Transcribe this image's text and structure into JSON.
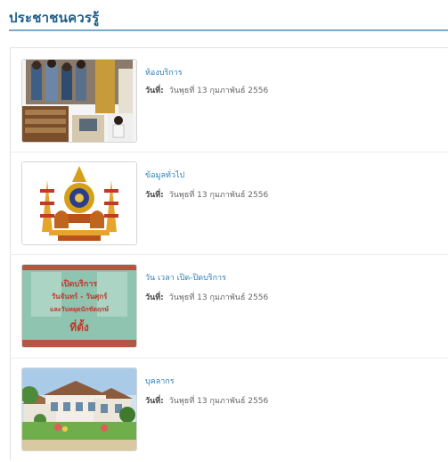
{
  "header": {
    "title": "ประชาชนควรรู้"
  },
  "date_label": "วันที่:",
  "items": [
    {
      "title": "ห้องบริการ",
      "date": "วันพุธที่ 13 กุมภาพันธ์ 2556",
      "image": "service-room-photo"
    },
    {
      "title": "ข้อมูลทั่วไป",
      "date": "วันพุธที่ 13 กุมภาพันธ์ 2556",
      "image": "royal-emblem"
    },
    {
      "title": "วัน เวลา เปิด-ปิดบริการ",
      "date": "วันพุธที่ 13 กุมภาพันธ์ 2556",
      "image": "opening-hours-poster",
      "poster_text": [
        "เปิดบริการ",
        "วันจันทร์ - วันศุกร์",
        "และวันหยุดนักขัตฤกษ์",
        "ที่ตั้ง"
      ]
    },
    {
      "title": "บุคลากร",
      "date": "วันพุธที่ 13 กุมภาพันธ์ 2556",
      "image": "building-photo"
    }
  ]
}
